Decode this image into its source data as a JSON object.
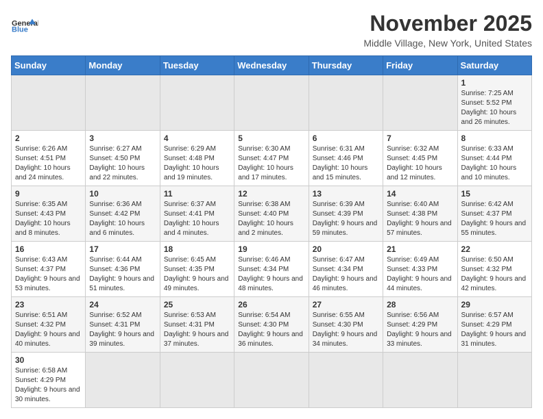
{
  "header": {
    "logo_general": "General",
    "logo_blue": "Blue",
    "month": "November 2025",
    "location": "Middle Village, New York, United States"
  },
  "weekdays": [
    "Sunday",
    "Monday",
    "Tuesday",
    "Wednesday",
    "Thursday",
    "Friday",
    "Saturday"
  ],
  "weeks": [
    [
      {
        "day": "",
        "info": ""
      },
      {
        "day": "",
        "info": ""
      },
      {
        "day": "",
        "info": ""
      },
      {
        "day": "",
        "info": ""
      },
      {
        "day": "",
        "info": ""
      },
      {
        "day": "",
        "info": ""
      },
      {
        "day": "1",
        "info": "Sunrise: 7:25 AM\nSunset: 5:52 PM\nDaylight: 10 hours and 26 minutes."
      }
    ],
    [
      {
        "day": "2",
        "info": "Sunrise: 6:26 AM\nSunset: 4:51 PM\nDaylight: 10 hours and 24 minutes."
      },
      {
        "day": "3",
        "info": "Sunrise: 6:27 AM\nSunset: 4:50 PM\nDaylight: 10 hours and 22 minutes."
      },
      {
        "day": "4",
        "info": "Sunrise: 6:29 AM\nSunset: 4:48 PM\nDaylight: 10 hours and 19 minutes."
      },
      {
        "day": "5",
        "info": "Sunrise: 6:30 AM\nSunset: 4:47 PM\nDaylight: 10 hours and 17 minutes."
      },
      {
        "day": "6",
        "info": "Sunrise: 6:31 AM\nSunset: 4:46 PM\nDaylight: 10 hours and 15 minutes."
      },
      {
        "day": "7",
        "info": "Sunrise: 6:32 AM\nSunset: 4:45 PM\nDaylight: 10 hours and 12 minutes."
      },
      {
        "day": "8",
        "info": "Sunrise: 6:33 AM\nSunset: 4:44 PM\nDaylight: 10 hours and 10 minutes."
      }
    ],
    [
      {
        "day": "9",
        "info": "Sunrise: 6:35 AM\nSunset: 4:43 PM\nDaylight: 10 hours and 8 minutes."
      },
      {
        "day": "10",
        "info": "Sunrise: 6:36 AM\nSunset: 4:42 PM\nDaylight: 10 hours and 6 minutes."
      },
      {
        "day": "11",
        "info": "Sunrise: 6:37 AM\nSunset: 4:41 PM\nDaylight: 10 hours and 4 minutes."
      },
      {
        "day": "12",
        "info": "Sunrise: 6:38 AM\nSunset: 4:40 PM\nDaylight: 10 hours and 2 minutes."
      },
      {
        "day": "13",
        "info": "Sunrise: 6:39 AM\nSunset: 4:39 PM\nDaylight: 9 hours and 59 minutes."
      },
      {
        "day": "14",
        "info": "Sunrise: 6:40 AM\nSunset: 4:38 PM\nDaylight: 9 hours and 57 minutes."
      },
      {
        "day": "15",
        "info": "Sunrise: 6:42 AM\nSunset: 4:37 PM\nDaylight: 9 hours and 55 minutes."
      }
    ],
    [
      {
        "day": "16",
        "info": "Sunrise: 6:43 AM\nSunset: 4:37 PM\nDaylight: 9 hours and 53 minutes."
      },
      {
        "day": "17",
        "info": "Sunrise: 6:44 AM\nSunset: 4:36 PM\nDaylight: 9 hours and 51 minutes."
      },
      {
        "day": "18",
        "info": "Sunrise: 6:45 AM\nSunset: 4:35 PM\nDaylight: 9 hours and 49 minutes."
      },
      {
        "day": "19",
        "info": "Sunrise: 6:46 AM\nSunset: 4:34 PM\nDaylight: 9 hours and 48 minutes."
      },
      {
        "day": "20",
        "info": "Sunrise: 6:47 AM\nSunset: 4:34 PM\nDaylight: 9 hours and 46 minutes."
      },
      {
        "day": "21",
        "info": "Sunrise: 6:49 AM\nSunset: 4:33 PM\nDaylight: 9 hours and 44 minutes."
      },
      {
        "day": "22",
        "info": "Sunrise: 6:50 AM\nSunset: 4:32 PM\nDaylight: 9 hours and 42 minutes."
      }
    ],
    [
      {
        "day": "23",
        "info": "Sunrise: 6:51 AM\nSunset: 4:32 PM\nDaylight: 9 hours and 40 minutes."
      },
      {
        "day": "24",
        "info": "Sunrise: 6:52 AM\nSunset: 4:31 PM\nDaylight: 9 hours and 39 minutes."
      },
      {
        "day": "25",
        "info": "Sunrise: 6:53 AM\nSunset: 4:31 PM\nDaylight: 9 hours and 37 minutes."
      },
      {
        "day": "26",
        "info": "Sunrise: 6:54 AM\nSunset: 4:30 PM\nDaylight: 9 hours and 36 minutes."
      },
      {
        "day": "27",
        "info": "Sunrise: 6:55 AM\nSunset: 4:30 PM\nDaylight: 9 hours and 34 minutes."
      },
      {
        "day": "28",
        "info": "Sunrise: 6:56 AM\nSunset: 4:29 PM\nDaylight: 9 hours and 33 minutes."
      },
      {
        "day": "29",
        "info": "Sunrise: 6:57 AM\nSunset: 4:29 PM\nDaylight: 9 hours and 31 minutes."
      }
    ],
    [
      {
        "day": "30",
        "info": "Sunrise: 6:58 AM\nSunset: 4:29 PM\nDaylight: 9 hours and 30 minutes."
      },
      {
        "day": "",
        "info": ""
      },
      {
        "day": "",
        "info": ""
      },
      {
        "day": "",
        "info": ""
      },
      {
        "day": "",
        "info": ""
      },
      {
        "day": "",
        "info": ""
      },
      {
        "day": "",
        "info": ""
      }
    ]
  ]
}
